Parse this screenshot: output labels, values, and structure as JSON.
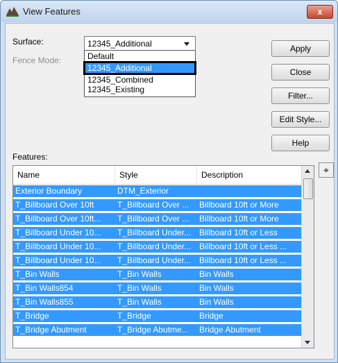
{
  "window": {
    "title": "View Features",
    "close_label": "x"
  },
  "form": {
    "surface_label": "Surface:",
    "fence_mode_label": "Fence Mode:",
    "surface_value": "12345_Additional",
    "surface_options": [
      "Default",
      "12345_Additional",
      "12345_Combined",
      "12345_Existing"
    ],
    "features_label": "Features:"
  },
  "buttons": {
    "apply": "Apply",
    "close": "Close",
    "filter": "Filter...",
    "edit_style": "Edit Style...",
    "help": "Help",
    "target_icon": "crosshair-icon",
    "target_glyph": "⌖"
  },
  "table": {
    "columns": [
      "Name",
      "Style",
      "Description"
    ],
    "rows": [
      [
        "Exterior Boundary",
        "DTM_Exterior",
        ""
      ],
      [
        "T_Billboard Over 10ft",
        "T_Billboard Over ...",
        "Billboard 10ft or More"
      ],
      [
        "T_Billboard Over 10ft...",
        "T_Billboard Over ...",
        "Billboard 10ft or More"
      ],
      [
        "T_Billboard Under 10...",
        "T_Billboard Under...",
        "Billboard 10ft or Less"
      ],
      [
        "T_Billboard Under 10...",
        "T_Billboard Under...",
        "Billboard 10ft or Less ..."
      ],
      [
        "T_Billboard Under 10...",
        "T_Billboard Under...",
        "Billboard 10ft or Less ..."
      ],
      [
        "T_Bin Walls",
        "T_Bin Walls",
        "Bin Walls"
      ],
      [
        "T_Bin Walls854",
        "T_Bin Walls",
        "Bin Walls"
      ],
      [
        "T_Bin Walls855",
        "T_Bin Walls",
        "Bin Walls"
      ],
      [
        "T_Bridge",
        "T_Bridge",
        "Bridge"
      ],
      [
        "T_Bridge Abutment",
        "T_Bridge Abutme...",
        "Bridge Abutment"
      ]
    ]
  },
  "colors": {
    "selection": "#3399ff",
    "window_frame": "#cfe0f1"
  }
}
